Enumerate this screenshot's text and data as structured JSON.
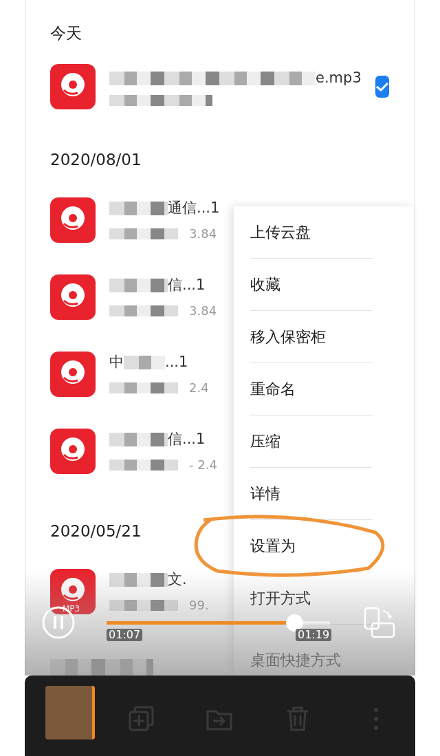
{
  "sections": [
    {
      "header": "今天",
      "files": [
        {
          "title": "e.mp3",
          "checked": true
        }
      ]
    },
    {
      "header": "2020/08/01",
      "files": [
        {
          "title": "通信...1",
          "meta": "3.84"
        },
        {
          "title": "信...1",
          "meta": "3.84"
        },
        {
          "title_start": "中",
          "title": "...1",
          "meta": "2.4"
        },
        {
          "title": "信...1",
          "meta": "- 2.4"
        }
      ]
    },
    {
      "header": "2020/05/21",
      "files": [
        {
          "title": "文.",
          "meta": "99.",
          "badge": "MP3"
        }
      ]
    },
    {
      "header_redacted": true
    }
  ],
  "context_menu": {
    "items": [
      {
        "label": "上传云盘",
        "circled": false
      },
      {
        "label": "收藏",
        "circled": false
      },
      {
        "label": "移入保密柜",
        "circled": false
      },
      {
        "label": "重命名",
        "circled": false
      },
      {
        "label": "压缩",
        "circled": false
      },
      {
        "label": "详情",
        "circled": false
      },
      {
        "label": "设置为",
        "circled": true
      },
      {
        "label": "打开方式",
        "circled": false
      },
      {
        "label": "桌面快捷方式",
        "circled": false
      }
    ]
  },
  "player": {
    "playing": true,
    "level": 0.84,
    "elapsed": "01:07",
    "total": "01:19"
  },
  "toolbar": {
    "actions": [
      {
        "kind": "copy"
      },
      {
        "kind": "move"
      },
      {
        "kind": "delete"
      },
      {
        "kind": "more"
      }
    ]
  }
}
